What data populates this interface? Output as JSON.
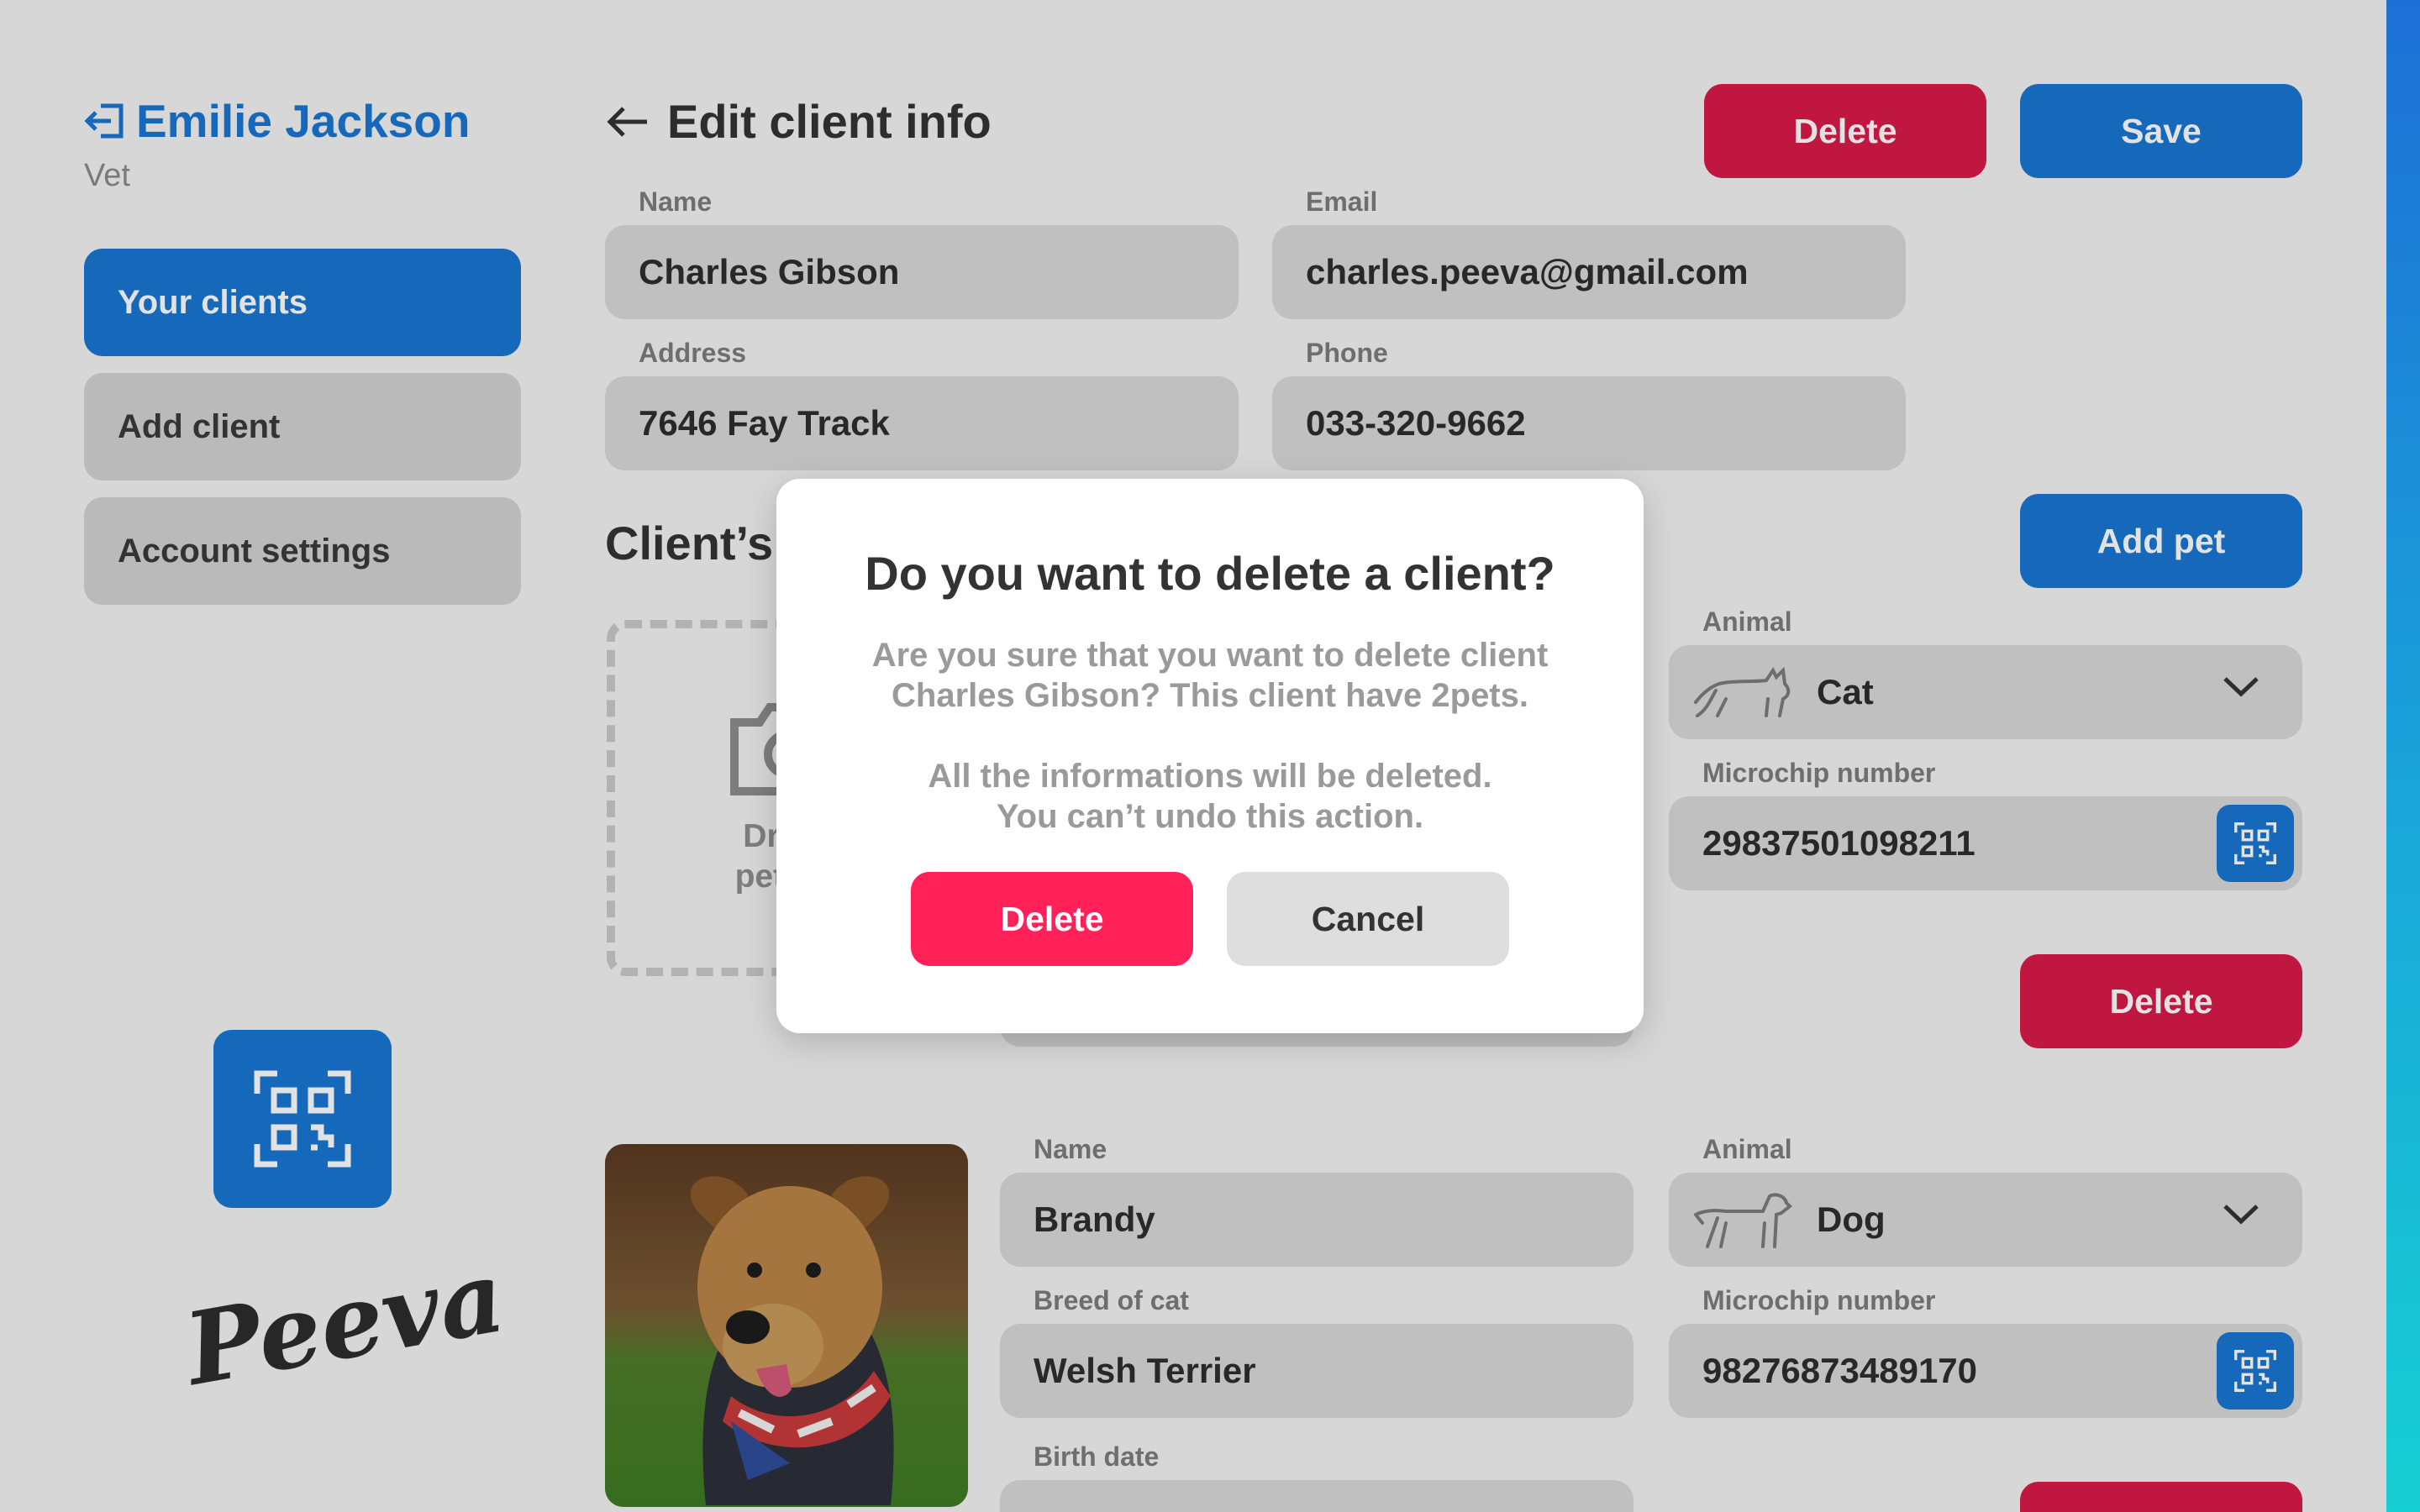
{
  "sidebar": {
    "user_name": "Emilie Jackson",
    "user_role": "Vet",
    "items": [
      {
        "label": "Your clients",
        "active": true
      },
      {
        "label": "Add client",
        "active": false
      },
      {
        "label": "Account settings",
        "active": false
      }
    ],
    "logo_text": "Peeva",
    "qr_icon": "qr-scan-icon"
  },
  "header": {
    "title": "Edit client info",
    "delete_label": "Delete",
    "save_label": "Save"
  },
  "client": {
    "name_label": "Name",
    "name_value": "Charles Gibson",
    "email_label": "Email",
    "email_value": "charles.peeva@gmail.com",
    "address_label": "Address",
    "address_value": "7646 Fay Track",
    "phone_label": "Phone",
    "phone_value": "033-320-9662"
  },
  "pets_section": {
    "title": "Client’s p",
    "add_pet_label": "Add pet",
    "drop_text_line1": "Drag a",
    "drop_text_line2": "pet pho"
  },
  "pets": [
    {
      "animal_label": "Animal",
      "animal_value": "Cat",
      "microchip_label": "Microchip number",
      "microchip_value": "29837501098211",
      "delete_label": "Delete"
    },
    {
      "name_label": "Name",
      "name_value": "Brandy",
      "breed_label": "Breed of cat",
      "breed_value": "Welsh Terrier",
      "birth_label": "Birth date",
      "animal_label": "Animal",
      "animal_value": "Dog",
      "microchip_label": "Microchip number",
      "microchip_value": "98276873489170"
    }
  ],
  "modal": {
    "title": "Do you want to delete a client?",
    "body_line1": "Are you sure that you want to delete client",
    "body_line2": "Charles Gibson? This client have 2pets.",
    "body_line3": "All the informations will be deleted.",
    "body_line4": "You can’t undo this action.",
    "delete_label": "Delete",
    "cancel_label": "Cancel"
  },
  "colors": {
    "accent": "#1976d2",
    "danger": "#d81a48",
    "danger_modal": "#ff2158"
  }
}
